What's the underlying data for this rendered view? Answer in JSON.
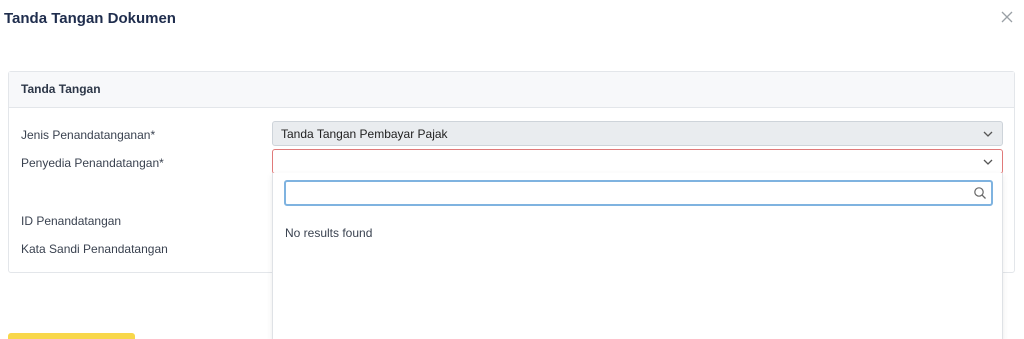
{
  "modal": {
    "title": "Tanda Tangan Dokumen",
    "close_icon": "close-icon"
  },
  "card": {
    "header": "Tanda Tangan",
    "fields": {
      "jenis_label": "Jenis Penandatanganan*",
      "jenis_value": "Tanda Tangan Pembayar Pajak",
      "penyedia_label": "Penyedia Penandatangan*",
      "penyedia_value": "",
      "id_label": "ID Penandatangan",
      "sandi_label": "Kata Sandi Penandatangan"
    }
  },
  "dropdown": {
    "search_value": "",
    "search_icon": "search-icon",
    "no_results": "No results found"
  },
  "colors": {
    "title": "#1f2d4d",
    "error_border": "#e07a7a",
    "focus_border": "#7fb3e0",
    "primary_button": "#f8d74a"
  }
}
